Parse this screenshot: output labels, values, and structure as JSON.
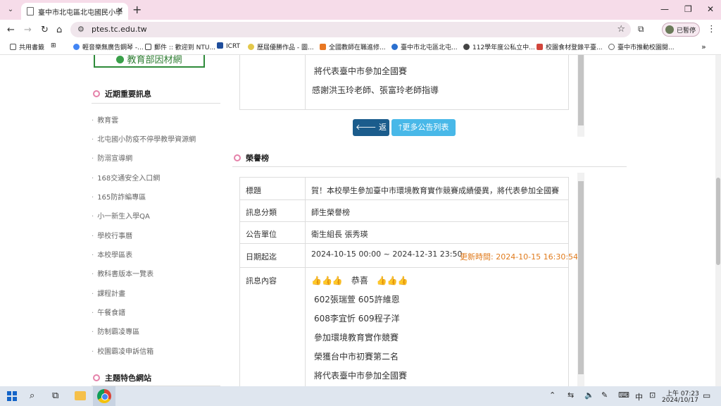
{
  "browser": {
    "tab_title": "臺中市北屯區北屯國民小學",
    "url": "ptes.tc.edu.tw",
    "profile_label": "已暫停",
    "bookmarks": [
      "共用書籤",
      "輕音樂無廣告鋼琴 -...",
      "郵件 :: 歡迎到 NTU...",
      "ICRT",
      "歷屆優勝作品 - 圖...",
      "全國教師在職進修...",
      "臺中市北屯區北屯...",
      "112學年度公私立中...",
      "校園食材登錄平臺...",
      "臺中市推動校園閱..."
    ]
  },
  "sidebar": {
    "banner": "教育部因材網",
    "heading_recent": "近期重要訊息",
    "items": [
      "教育雲",
      "北屯國小防疫不停學教學資源網",
      "防溺宣導網",
      "168交通安全入口網",
      "165防詐編專區",
      "小一新生入學QA",
      "學校行事曆",
      "本校學區表",
      "教科書版本一覽表",
      "課程計畫",
      "午餐食譜",
      "防制霸凌專區",
      "校園霸凌申訴信箱"
    ],
    "heading_theme": "主題特色網站"
  },
  "upper": {
    "lines": [
      "將代表臺中市參加全國賽",
      "感謝洪玉玲老師、張富玲老師指導"
    ]
  },
  "buttons": {
    "back": "返回",
    "more": "更多公告列表"
  },
  "section": {
    "title": "榮譽榜"
  },
  "table": {
    "title_label": "標題",
    "title_value": "賀！本校學生參加臺中市環境教育實作競賽成績優異，將代表參加全國賽",
    "category_label": "訊息分類",
    "category_value": "師生榮譽榜",
    "unit_label": "公告單位",
    "unit_value": "衛生組長 張秀瑛",
    "date_label": "日期起迄",
    "date_value": "2024-10-15 00:00 ~ 2024-12-31 23:50",
    "updated": "更新時間: 2024-10-15 16:30:54",
    "content_label": "訊息內容",
    "content_lines": [
      "👍👍👍　恭喜　👍👍👍",
      "602張瑞萱 605許維恩",
      "608李宜忻 609程子洋",
      "參加環境教育實作競賽",
      "榮獲台中市初賽第二名",
      "將代表臺中市參加全國賽"
    ]
  },
  "taskbar": {
    "ime": "中",
    "time": "上午 07:23",
    "date": "2024/10/17"
  }
}
